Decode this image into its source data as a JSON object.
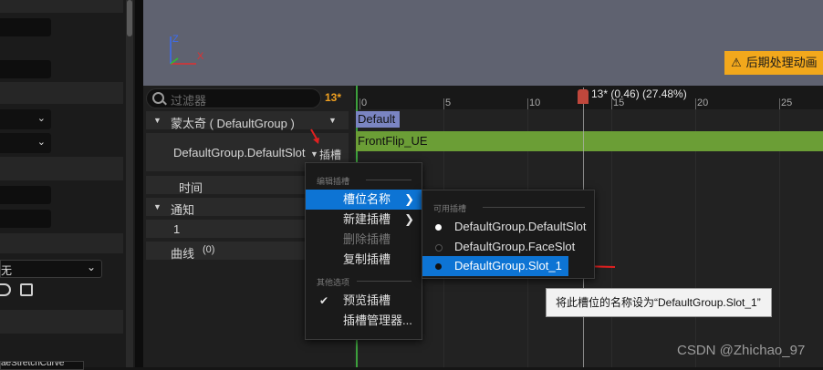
{
  "left_panel": {
    "combo_value": "无",
    "bottom_text": "aeStretchCurve"
  },
  "viewport": {
    "axis_z": "Z",
    "axis_x": "X",
    "warning_text": "后期处理动画",
    "warning_icon": "warning-triangle-icon"
  },
  "tracklist": {
    "filter_placeholder": "过滤器",
    "frame_count": "13*",
    "rows": {
      "group": "蒙太奇 ( DefaultGroup )",
      "slot": "DefaultGroup.DefaultSlot",
      "slot_dropdown": "插槽",
      "time": "时间",
      "notifies": "通知",
      "notify_track": "1",
      "curves": "曲线",
      "curves_count": "(0)"
    }
  },
  "timeline": {
    "scrub_label": "13* (0.46) (27.48%)",
    "tick_labels": [
      "0",
      "5",
      "10",
      "15",
      "20",
      "25"
    ],
    "slot_label": "Default",
    "segment_label": "FrontFlip_UE"
  },
  "context_menu": {
    "section_edit": "编辑插槽",
    "items": [
      "槽位名称",
      "新建插槽",
      "删除插槽",
      "复制插槽"
    ],
    "section_other": "其他选项",
    "preview_check": "✔",
    "preview_item": "预览插槽",
    "manager_item": "插槽管理器..."
  },
  "submenu": {
    "section": "可用插槽",
    "items": [
      "DefaultGroup.DefaultSlot",
      "DefaultGroup.FaceSlot",
      "DefaultGroup.Slot_1"
    ],
    "dot_colors": [
      "#ffffff",
      "#111111",
      "#111111"
    ]
  },
  "tooltip": "将此槽位的名称设为“DefaultGroup.Slot_1”",
  "watermark": "CSDN @Zhichao_97",
  "colors": {
    "accent": "#0d74d4",
    "warning": "#f2a81c",
    "segment": "#6b9e36",
    "slot": "#7a84c2",
    "annotation_red": "#e02020"
  }
}
